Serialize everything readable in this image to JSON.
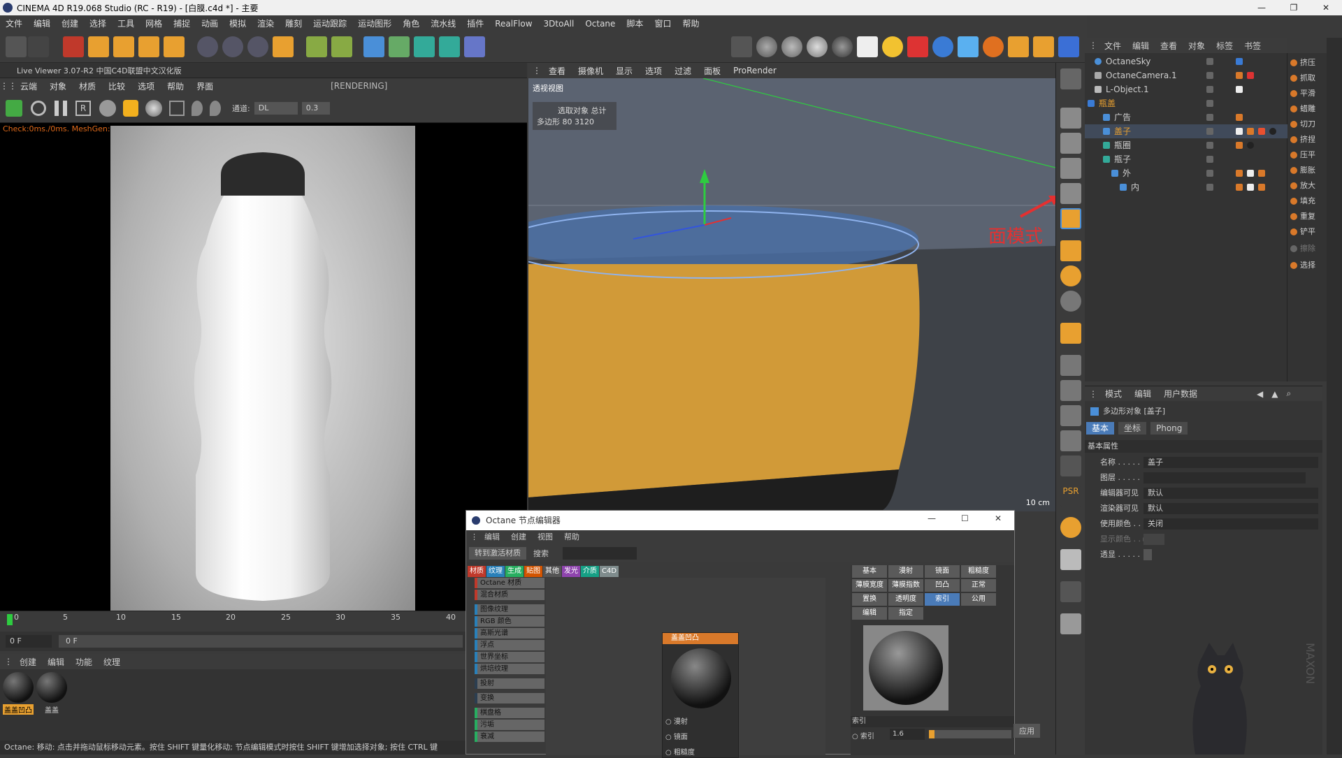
{
  "titlebar": {
    "title": "CINEMA 4D R19.068 Studio (RC - R19) - [白膜.c4d *] - 主要",
    "min": "—",
    "max": "❐",
    "close": "✕"
  },
  "menubar": [
    "文件",
    "编辑",
    "创建",
    "选择",
    "工具",
    "网格",
    "捕捉",
    "动画",
    "模拟",
    "渲染",
    "雕刻",
    "运动跟踪",
    "运动图形",
    "角色",
    "流水线",
    "插件",
    "RealFlow",
    "3DtoAll",
    "Octane",
    "脚本",
    "窗口",
    "帮助"
  ],
  "liveviewer": {
    "title": "Live Viewer 3.07-R2 中国C4D联盟中文汉化版",
    "menu": [
      "云端",
      "对象",
      "材质",
      "比较",
      "选项",
      "帮助",
      "界面"
    ],
    "rendering": "[RENDERING]",
    "channel_label": "通道:",
    "channel_value": "DL",
    "channel_num": "0.3",
    "status": "Check:0ms./0ms. MeshGen:1ms. Update[G]:230ms. Mesh:4 Nodes:25 Movable:6  0 0"
  },
  "timeline": {
    "ticks": [
      "0",
      "5",
      "10",
      "15",
      "20",
      "25",
      "30",
      "35",
      "40"
    ],
    "frame_field": "0 F",
    "frame_field2": "0 F"
  },
  "material_manager": {
    "menu": [
      "创建",
      "编辑",
      "功能",
      "纹理"
    ],
    "materials": [
      "盖盖凹凸",
      "盖盖"
    ]
  },
  "statusbar": "Octane:      移动: 点击并拖动鼠标移动元素。按住 SHIFT 键量化移动; 节点编辑模式时按住 SHIFT 键增加选择对象; 按住 CTRL 键",
  "viewport": {
    "menu": [
      "查看",
      "摄像机",
      "显示",
      "选项",
      "过滤",
      "面板",
      "ProRender"
    ],
    "label": "透视视图",
    "info_header": "选取对象  总计",
    "info_row": "多边形  80      3120",
    "scale": "10 cm"
  },
  "annotation": "面模式",
  "object_manager": {
    "menu": [
      "文件",
      "编辑",
      "查看",
      "对象",
      "标签",
      "书签"
    ],
    "objects": [
      {
        "name": "OctaneSky",
        "indent": 0
      },
      {
        "name": "OctaneCamera.1",
        "indent": 0
      },
      {
        "name": "L-Object.1",
        "indent": 0
      },
      {
        "name": "瓶盖",
        "indent": 0,
        "color": "#e8a030"
      },
      {
        "name": "广告",
        "indent": 1
      },
      {
        "name": "盖子",
        "indent": 1,
        "color": "#e8a030"
      },
      {
        "name": "瓶圈",
        "indent": 1
      },
      {
        "name": "瓶子",
        "indent": 1
      },
      {
        "name": "外",
        "indent": 2
      },
      {
        "name": "内",
        "indent": 3
      }
    ]
  },
  "tools_right": [
    "挤压",
    "抓取",
    "平滑",
    "蜡雕",
    "切刀",
    "挤捏",
    "压平",
    "膨胀",
    "放大",
    "填充",
    "重复",
    "铲平",
    "擦除",
    "选择"
  ],
  "attribute_manager": {
    "menu": [
      "模式",
      "编辑",
      "用户数据"
    ],
    "object": "多边形对象 [盖子]",
    "tabs": [
      "基本",
      "坐标",
      "Phong"
    ],
    "section": "基本属性",
    "fields": [
      {
        "label": "名称 . . . . .",
        "value": "盖子"
      },
      {
        "label": "图层 . . . . .",
        "value": ""
      },
      {
        "label": "编辑器可见",
        "value": "默认"
      },
      {
        "label": "渲染器可见",
        "value": "默认"
      },
      {
        "label": "使用颜色 . .",
        "value": "关闭"
      },
      {
        "label": "显示颜色 . . ▸",
        "value": ""
      },
      {
        "label": "透显 . . . . .",
        "value": ""
      }
    ]
  },
  "node_editor": {
    "title": "Octane 节点编辑器",
    "menu": [
      "编辑",
      "创建",
      "视图",
      "帮助"
    ],
    "button": "转到激活材质",
    "search_label": "搜索",
    "categories": [
      "材质",
      "纹理",
      "生成",
      "贴图",
      "其他",
      "发光",
      "介质",
      "C4D"
    ],
    "list": [
      "Octane 材质",
      "混合材质",
      "图像纹理",
      "RGB 颜色",
      "高斯光谱",
      "浮点",
      "世界坐标",
      "烘培纹理",
      "投射",
      "变换",
      "棋盘格",
      "污垢",
      "衰减"
    ],
    "node_title": "盖盖凹凸",
    "node_ports": [
      "漫射",
      "镜面",
      "粗糙度"
    ],
    "prop_tabs": [
      "基本",
      "漫射",
      "镜面",
      "粗糙度",
      "薄膜宽度",
      "薄膜指数",
      "凹凸",
      "正常",
      "置换",
      "透明度",
      "索引",
      "公用",
      "编辑",
      "指定"
    ],
    "index_label": "索引",
    "index_field_label": "索引",
    "index_value": "1.6",
    "apply": "应用"
  },
  "colors": {
    "accent": "#d9792a",
    "face_select": "#e0a530",
    "lv_status": "#e06a1a",
    "annotation": "#e53030"
  }
}
